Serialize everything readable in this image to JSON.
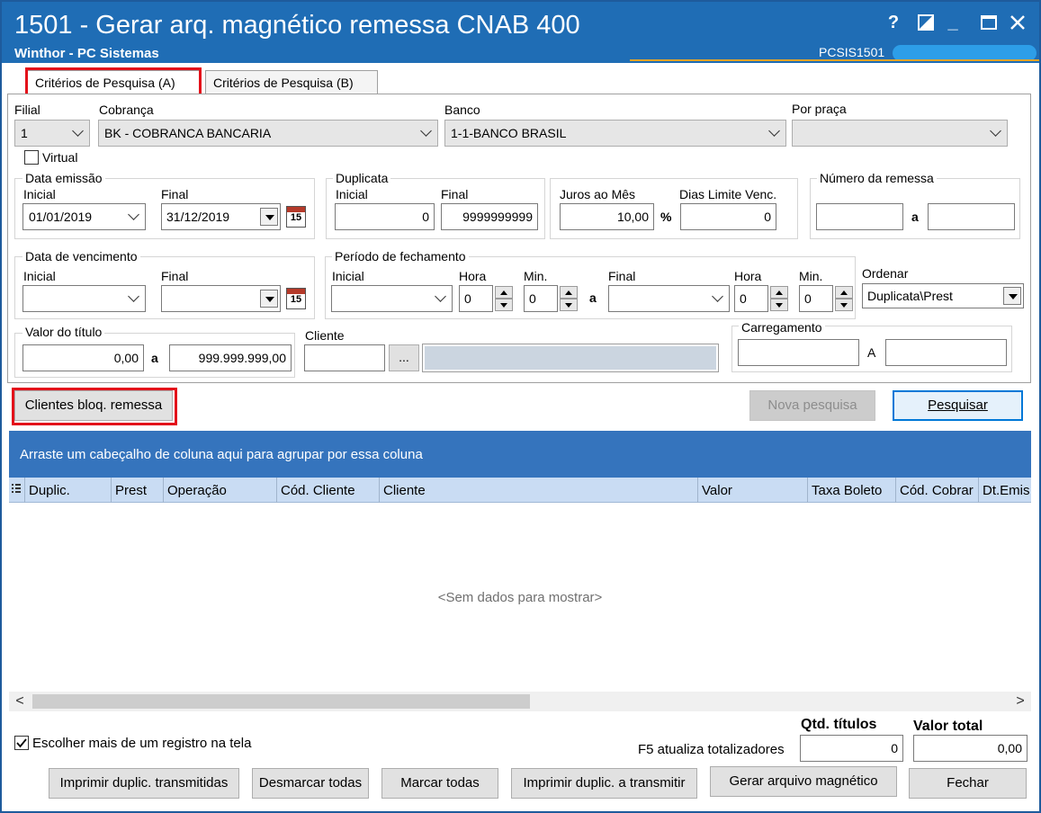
{
  "window": {
    "title": "1501 - Gerar arq. magnético remessa CNAB 400",
    "subtitle": "Winthor - PC Sistemas",
    "program_id": "PCSIS1501",
    "help_icon": "?",
    "minimize_icon": "_"
  },
  "tabs": [
    {
      "label": "Critérios de Pesquisa (A)",
      "active": true
    },
    {
      "label": "Critérios de Pesquisa (B)",
      "active": false
    }
  ],
  "filters": {
    "filial_label": "Filial",
    "filial_value": "1",
    "cobranca_label": "Cobrança",
    "cobranca_value": "BK - COBRANCA BANCARIA",
    "banco_label": "Banco",
    "banco_value": "1-1-BANCO BRASIL",
    "praca_label": "Por praça",
    "praca_value": "",
    "virtual_label": "Virtual",
    "virtual_checked": false
  },
  "data_emissao": {
    "label": "Data emissão",
    "inicial_label": "Inicial",
    "inicial_value": "01/01/2019",
    "final_label": "Final",
    "final_value": "31/12/2019",
    "calendar_num": "15"
  },
  "duplicata": {
    "label": "Duplicata",
    "inicial_label": "Inicial",
    "inicial_value": "0",
    "final_label": "Final",
    "final_value": "9999999999"
  },
  "juros": {
    "label": "Juros ao Mês",
    "value": "10,00",
    "unit": "%",
    "dias_label": "Dias Limite Venc.",
    "dias_value": "0"
  },
  "numero_remessa": {
    "label": "Número da remessa",
    "from": "",
    "sep": "a",
    "to": ""
  },
  "data_vencimento": {
    "label": "Data de vencimento",
    "inicial_label": "Inicial",
    "inicial_value": "",
    "final_label": "Final",
    "final_value": "",
    "calendar_num": "15"
  },
  "periodo": {
    "label": "Período de fechamento",
    "inicial_label": "Inicial",
    "hora_label": "Hora",
    "min_label": "Min.",
    "hora1": "0",
    "min1": "0",
    "sep": "a",
    "final_label": "Final",
    "hora2": "0",
    "min2": "0"
  },
  "ordenar": {
    "label": "Ordenar",
    "value": "Duplicata\\Prest"
  },
  "valor_titulo": {
    "label": "Valor do título",
    "from": "0,00",
    "sep": "a",
    "to": "999.999.999,00"
  },
  "cliente": {
    "label": "Cliente",
    "code": "",
    "browse": "...",
    "name": ""
  },
  "carregamento": {
    "label": "Carregamento",
    "from": "",
    "sep": "A",
    "to": ""
  },
  "actions": {
    "clientes_bloq": "Clientes bloq. remessa",
    "nova_pesquisa": "Nova pesquisa",
    "pesquisar": "Pesquisar"
  },
  "grid": {
    "group_hint": "Arraste um cabeçalho de coluna aqui para agrupar por essa coluna",
    "columns": [
      "Duplic.",
      "Prest",
      "Operação",
      "Cód. Cliente",
      "Cliente",
      "Valor",
      "Taxa Boleto",
      "Cód. Cobrar",
      "Dt.Emis"
    ],
    "empty_text": "<Sem dados para mostrar>",
    "scroll_left": "<",
    "scroll_right": ">"
  },
  "footer": {
    "multi_select_label": "Escolher mais de um registro na tela",
    "multi_select_checked": true,
    "f5_hint": "F5 atualiza totalizadores",
    "qtd_label": "Qtd. títulos",
    "qtd_value": "0",
    "total_label": "Valor total",
    "total_value": "0,00",
    "buttons": {
      "imprimir_transmitidas": "Imprimir duplic. transmitidas",
      "desmarcar": "Desmarcar todas",
      "marcar": "Marcar todas",
      "imprimir_transmitir": "Imprimir duplic. a transmitir",
      "gerar": "Gerar arquivo magnético",
      "fechar": "Fechar"
    }
  },
  "colors": {
    "titlebar": "#1f6db5",
    "accent_line": "#e7a427",
    "grid_group_bar": "#3574bd",
    "grid_header": "#c9dcf3",
    "highlight_box": "#e3101a"
  }
}
